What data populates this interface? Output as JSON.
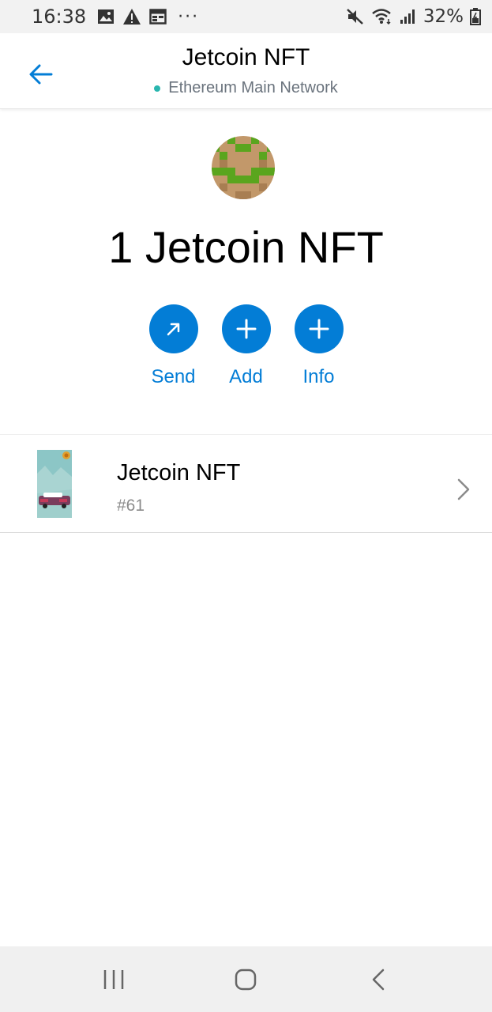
{
  "status_bar": {
    "time": "16:38",
    "dots": "···",
    "battery_percent": "32%",
    "left_icons": [
      "image-icon",
      "warning-icon",
      "calendar-icon"
    ],
    "right_icons": [
      "mute-icon",
      "wifi-icon",
      "signal-icon",
      "battery-icon"
    ]
  },
  "header": {
    "back_icon": "arrow-left-icon",
    "title": "Jetcoin NFT",
    "network": "Ethereum Main Network",
    "network_dot_color": "#29b6af"
  },
  "token": {
    "balance_text": "1 Jetcoin NFT"
  },
  "actions": [
    {
      "label": "Send",
      "icon": "arrow-up-right-icon"
    },
    {
      "label": "Add",
      "icon": "plus-icon"
    },
    {
      "label": "Info",
      "icon": "plus-icon"
    }
  ],
  "nfts": [
    {
      "name": "Jetcoin NFT",
      "id": "#61"
    }
  ],
  "nav_bar": {
    "icons": [
      "recent-apps-icon",
      "home-icon",
      "back-icon"
    ]
  },
  "colors": {
    "accent": "#037dd6",
    "text": "#000000",
    "muted": "#6a737d"
  }
}
